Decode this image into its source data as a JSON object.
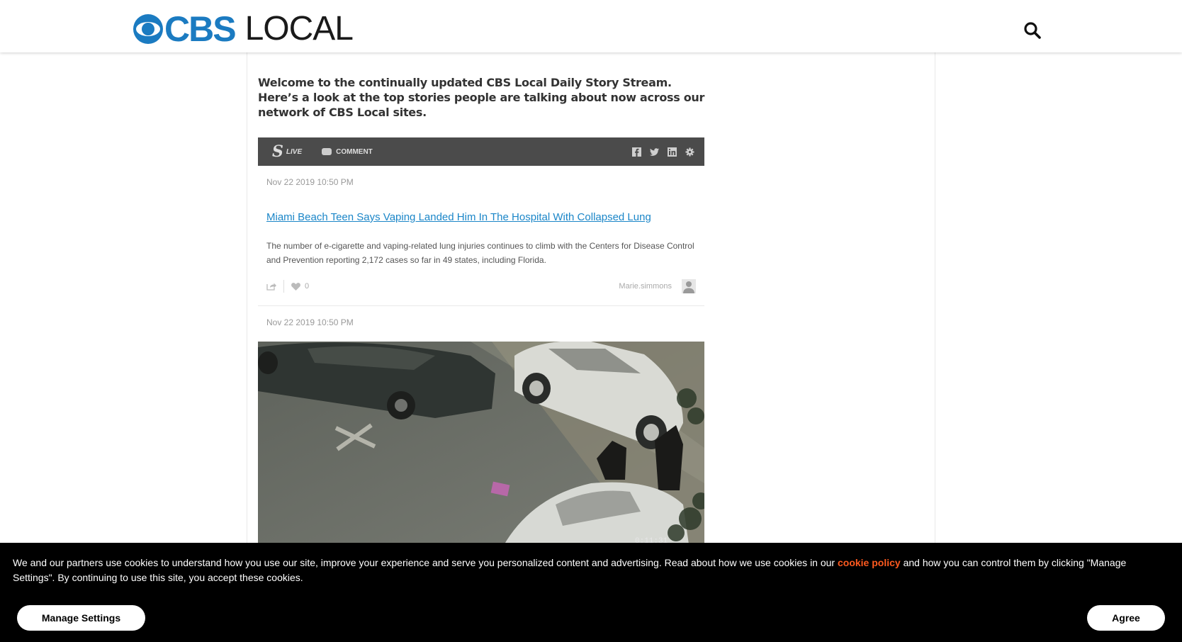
{
  "header": {
    "logo_brand": "CBS",
    "logo_local": "LOCAL",
    "search_icon": "search-icon"
  },
  "intro": "Welcome to the continually updated CBS Local Daily Story Stream. Here’s a look at the top stories people are talking about now across our network of CBS Local sites.",
  "stream": {
    "live_label": "LIVE",
    "comment_label": "COMMENT",
    "icons": [
      "facebook-icon",
      "twitter-icon",
      "linkedin-icon",
      "gear-icon"
    ],
    "posts": [
      {
        "date": "Nov 22 2019 10:50 PM",
        "title": "Miami Beach Teen Says Vaping Landed Him In The Hospital With Collapsed Lung",
        "description": "The number of e-cigarette and vaping-related lung injuries continues to climb with the Centers for Disease Control and Prevention reporting 2,172 cases so far in 49 states, including Florida.",
        "likes": "0",
        "author": "Marie.simmons"
      },
      {
        "date": "Nov 22 2019 10:50 PM"
      }
    ]
  },
  "cookie": {
    "text_before": "We and our partners use cookies to understand how you use our site, improve your experience and serve you personalized content and advertising. Read about how we use cookies in our ",
    "link": "cookie policy",
    "text_after": " and how you can control them by clicking \"Manage Settings\". By continuing to use this site, you accept these cookies.",
    "manage_label": "Manage Settings",
    "agree_label": "Agree"
  },
  "colors": {
    "brand_blue": "#1b7bc1",
    "link_blue": "#1b86c8",
    "cookie_link": "#ff5a1f",
    "bar_gray": "#4b4b4b"
  }
}
